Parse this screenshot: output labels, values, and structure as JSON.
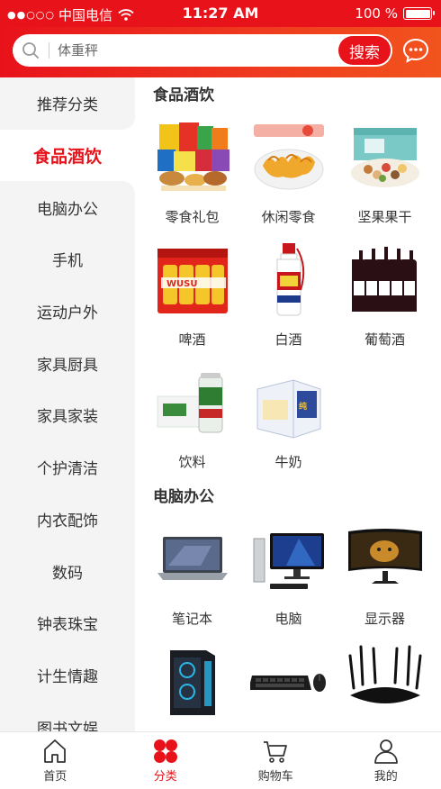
{
  "status_bar": {
    "signal": "●●○○○",
    "carrier": "中国电信",
    "time": "11:27 AM",
    "battery": "100 %",
    "battery_level": 1.0
  },
  "header": {
    "search_placeholder": "体重秤",
    "search_button": "搜索",
    "accent_color": "#e8121b"
  },
  "sidebar": {
    "items": [
      {
        "label": "推荐分类"
      },
      {
        "label": "食品酒饮",
        "active": true
      },
      {
        "label": "电脑办公"
      },
      {
        "label": "手机"
      },
      {
        "label": "运动户外"
      },
      {
        "label": "家具厨具"
      },
      {
        "label": "家具家装"
      },
      {
        "label": "个护清洁"
      },
      {
        "label": "内衣配饰"
      },
      {
        "label": "数码"
      },
      {
        "label": "钟表珠宝"
      },
      {
        "label": "计生情趣"
      },
      {
        "label": "图书文娱"
      }
    ]
  },
  "sections": [
    {
      "title": "食品酒饮",
      "items": [
        {
          "label": "零食礼包",
          "icon": "snack-gift-pack-image"
        },
        {
          "label": "休闲零食",
          "icon": "casual-snack-image"
        },
        {
          "label": "坚果果干",
          "icon": "nuts-dried-fruit-image"
        },
        {
          "label": "啤酒",
          "icon": "beer-image"
        },
        {
          "label": "白酒",
          "icon": "baijiu-image"
        },
        {
          "label": "葡萄酒",
          "icon": "wine-image"
        },
        {
          "label": "饮料",
          "icon": "drinks-image"
        },
        {
          "label": "牛奶",
          "icon": "milk-image"
        }
      ]
    },
    {
      "title": "电脑办公",
      "items": [
        {
          "label": "笔记本",
          "icon": "laptop-image"
        },
        {
          "label": "电脑",
          "icon": "desktop-pc-image"
        },
        {
          "label": "显示器",
          "icon": "monitor-image"
        },
        {
          "label": "",
          "icon": "pc-case-image"
        },
        {
          "label": "",
          "icon": "keyboard-mouse-image"
        },
        {
          "label": "",
          "icon": "router-image"
        }
      ]
    }
  ],
  "tabbar": {
    "tabs": [
      {
        "label": "首页",
        "icon": "home-icon"
      },
      {
        "label": "分类",
        "icon": "category-icon",
        "active": true
      },
      {
        "label": "购物车",
        "icon": "cart-icon"
      },
      {
        "label": "我的",
        "icon": "user-icon"
      }
    ]
  }
}
